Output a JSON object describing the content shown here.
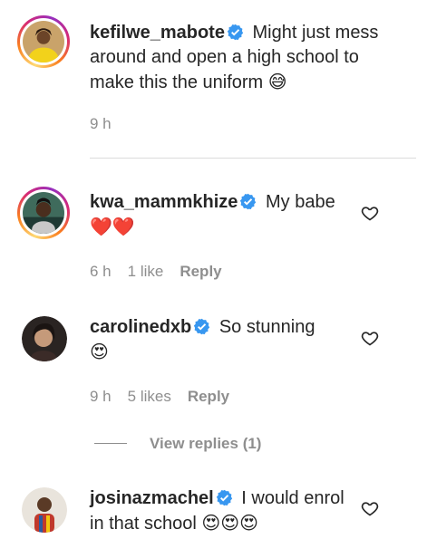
{
  "comments": [
    {
      "username": "kefilwe_mabote",
      "text": "Might just mess around and open a high school to make this the uniform",
      "emoji": "😅",
      "time": "9 h",
      "likes": "",
      "reply_label": ""
    },
    {
      "username": "kwa_mammkhize",
      "text": "My babe",
      "emoji": "❤️❤️",
      "time": "6 h",
      "likes": "1 like",
      "reply_label": "Reply"
    },
    {
      "username": "carolinedxb",
      "text": "So stunning",
      "emoji": "😍",
      "time": "9 h",
      "likes": "5 likes",
      "reply_label": "Reply"
    },
    {
      "username": "josinazmachel",
      "text": "I would enrol in that school",
      "emoji": "😍😍😍"
    }
  ],
  "view_replies": "View replies (1)",
  "colors": {
    "verified": "#3897f0",
    "muted": "#8e8e8e",
    "text": "#262626"
  }
}
